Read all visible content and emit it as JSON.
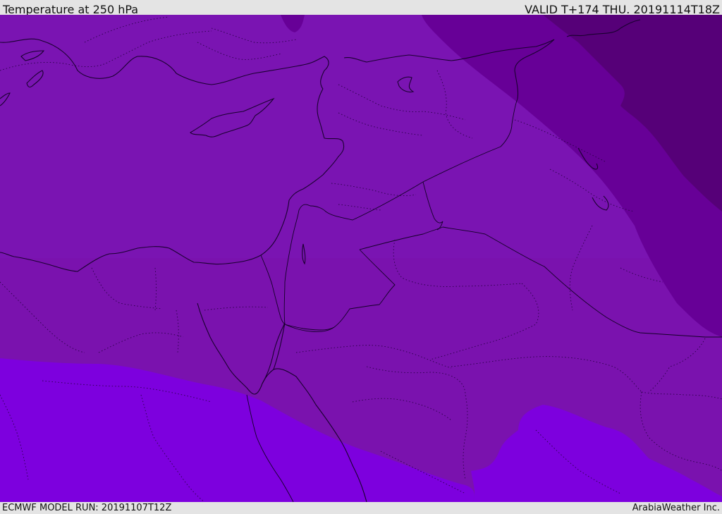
{
  "header": {
    "title": "Temperature at 250 hPa",
    "valid": "VALID T+174 THU. 20191114T18Z"
  },
  "footer": {
    "model_run": "ECMWF MODEL RUN: 20191107T12Z",
    "credit": "ArabiaWeather Inc."
  },
  "colors": {
    "band_warm": "#7d00de",
    "band_main": "#7a14b2",
    "band_mid": "#670097",
    "band_cold": "#560078",
    "band_south_overlay": "#7a12ae",
    "coastline": "#1a0030",
    "border": "#140028",
    "frame_bg": "#e4e4e4"
  },
  "map": {
    "field": "Temperature at 250 hPa",
    "legend": "none"
  }
}
